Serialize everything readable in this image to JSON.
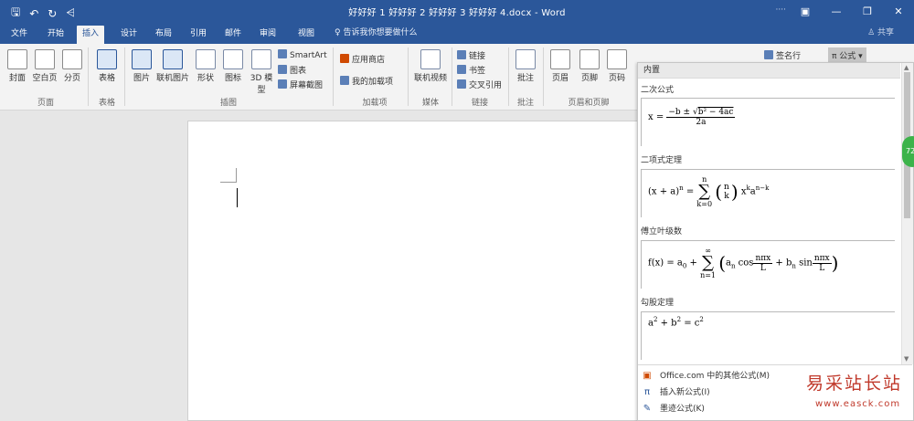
{
  "window": {
    "title": "好好好 1 好好好 2 好好好 3 好好好 4.docx - Word",
    "user": "····",
    "qat": {
      "save": "🖫",
      "undo": "↶",
      "redo": "↻",
      "customize": "⩤"
    }
  },
  "tabs": [
    "文件",
    "开始",
    "插入",
    "设计",
    "布局",
    "引用",
    "邮件",
    "审阅",
    "视图"
  ],
  "active_tab": "插入",
  "tell_me": "♀ 告诉我你想要做什么",
  "share": "♙ 共享",
  "ribbon": {
    "pages": {
      "cover": "封面",
      "blank": "空白页",
      "break": "分页",
      "group": "页面"
    },
    "tables": {
      "table": "表格",
      "group": "表格"
    },
    "illustrations": {
      "picture": "图片",
      "online_picture": "联机图片",
      "shapes": "形状",
      "icons": "图标",
      "model3d": "3D 模型",
      "smartart": "SmartArt",
      "chart": "图表",
      "screenshot": "屏幕截图",
      "group": "插图"
    },
    "addins": {
      "store": "应用商店",
      "my_addins": "我的加载项",
      "group": "加载项"
    },
    "media": {
      "online_video": "联机视频",
      "group": "媒体"
    },
    "links": {
      "link": "链接",
      "bookmark": "书签",
      "cross_ref": "交叉引用",
      "group": "链接"
    },
    "comments": {
      "comment": "批注",
      "group": "批注"
    },
    "header_footer": {
      "header": "页眉",
      "footer": "页脚",
      "page_number": "页码",
      "group": "页眉和页脚"
    },
    "text": {
      "signature": "签名行",
      "equation": "π 公式"
    }
  },
  "equation_panel": {
    "header": "内置",
    "items": [
      {
        "title": "二次公式",
        "formula": "x = (−b ± √(b² − 4ac)) / 2a"
      },
      {
        "title": "二项式定理",
        "formula": "(x + a)ⁿ = Σ(k=0..n) (n k) xᵏ aⁿ⁻ᵏ"
      },
      {
        "title": "傅立叶级数",
        "formula": "f(x) = a₀ + Σ(n=1..∞) (aₙ cos nπx/L + bₙ sin nπx/L)"
      },
      {
        "title": "勾股定理",
        "formula": "a² + b² = c²"
      }
    ],
    "menu": [
      {
        "label": "Office.com 中的其他公式(M)",
        "icon": "office-icon"
      },
      {
        "label": "插入新公式(I)",
        "icon": "pi-icon"
      },
      {
        "label": "墨迹公式(K)",
        "icon": "ink-icon"
      }
    ]
  },
  "side_bubble": "72",
  "watermark": {
    "cn": "易采站长站",
    "en": "www.easck.com"
  }
}
